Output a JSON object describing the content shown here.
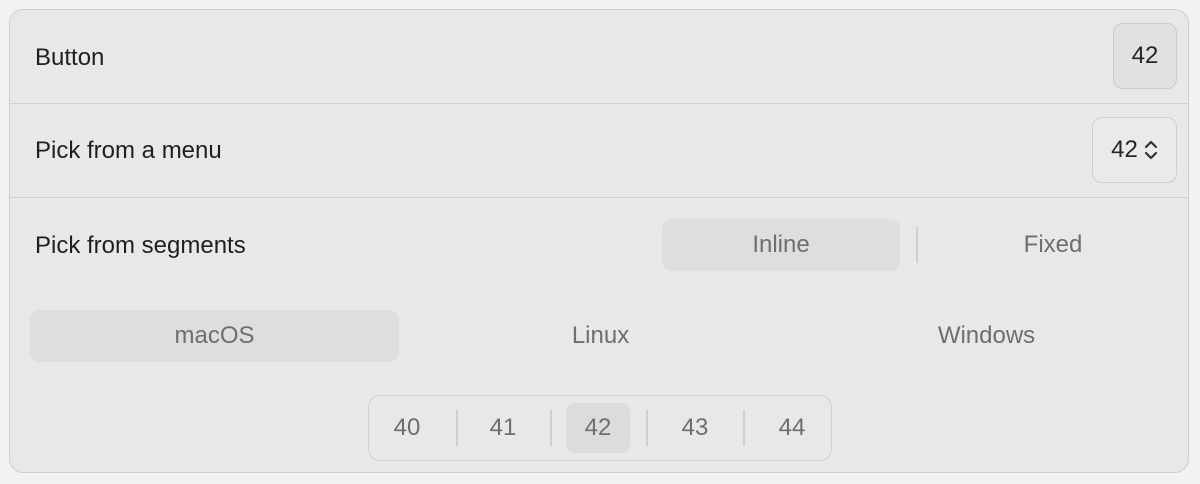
{
  "rows": {
    "button": {
      "label": "Button",
      "value": "42"
    },
    "menu": {
      "label": "Pick from a menu",
      "value": "42",
      "icon": "up-down-chevron-icon"
    },
    "segments": {
      "label": "Pick from segments",
      "mode_options": [
        "Inline",
        "Fixed"
      ],
      "mode_selected": "Inline",
      "os_options": [
        "macOS",
        "Linux",
        "Windows"
      ],
      "os_selected": "macOS",
      "number_options": [
        "40",
        "41",
        "42",
        "43",
        "44"
      ],
      "number_selected": "42"
    }
  },
  "colors": {
    "card_background": "#e8e8e8",
    "selected_segment": "#dedede",
    "text_primary": "#1f1f1f",
    "text_secondary": "#6e6e6e"
  }
}
